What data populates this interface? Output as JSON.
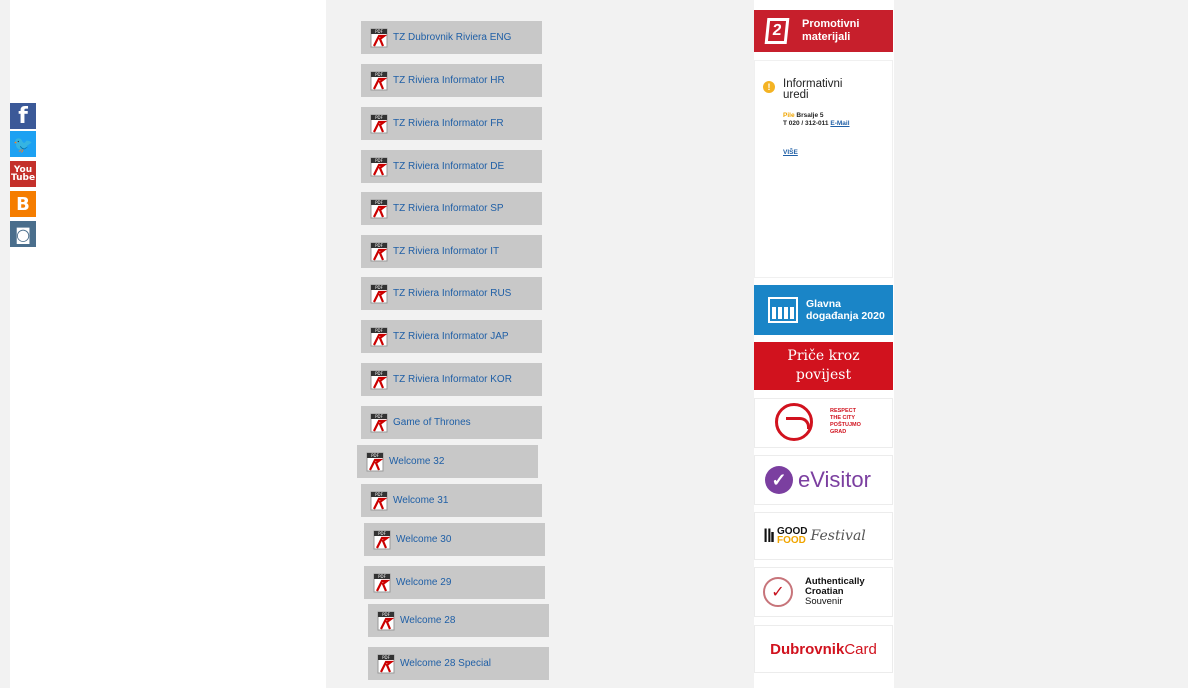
{
  "social": {
    "facebook": "f",
    "twitter": "🐦",
    "youtube_top": "You",
    "youtube_bottom": "Tube",
    "blogger": "B",
    "instagram": "◙"
  },
  "pdf_items": [
    {
      "label": "TZ Dubrovnik Riviera ENG"
    },
    {
      "label": "TZ Riviera Informator HR"
    },
    {
      "label": "TZ Riviera Informator FR"
    },
    {
      "label": "TZ Riviera Informator DE"
    },
    {
      "label": "TZ Riviera Informator SP"
    },
    {
      "label": "TZ Riviera Informator IT"
    },
    {
      "label": "TZ Riviera Informator RUS"
    },
    {
      "label": "TZ Riviera Informator JAP"
    },
    {
      "label": "TZ Riviera Informator KOR"
    },
    {
      "label": "Game of Thrones"
    },
    {
      "label": "Welcome 32"
    },
    {
      "label": "Welcome 31"
    },
    {
      "label": "Welcome 30"
    },
    {
      "label": "Welcome 29"
    },
    {
      "label": "Welcome 28"
    },
    {
      "label": "Welcome 28 Special"
    }
  ],
  "sidebar": {
    "promo_label_line1": "Promotivni",
    "promo_label_line2": "materijali",
    "info_title": "Informativni uredi",
    "info_office_name": "Pile",
    "info_office_street": "Brsalje 5",
    "info_phone": "T 020 / 312-011",
    "info_email": "E-Mail",
    "info_more": "VIŠE",
    "events_line1": "Glavna",
    "events_line2": "događanja 2020",
    "stories_line1": "Priče kroz",
    "stories_line2": "povijest",
    "respect_lines": [
      "RESPECT",
      "THE CITY",
      "POŠTUJMO",
      "GRAD"
    ],
    "evisitor": "eVisitor",
    "goodfood_good": "GOOD",
    "goodfood_food": "FOOD",
    "goodfood_festival": "Festival",
    "croatian_line1": "Authentically",
    "croatian_line2": "Croatian",
    "croatian_line3": "Souvenir",
    "dcard_1": "Dubrovnik",
    "dcard_2": "Card"
  }
}
